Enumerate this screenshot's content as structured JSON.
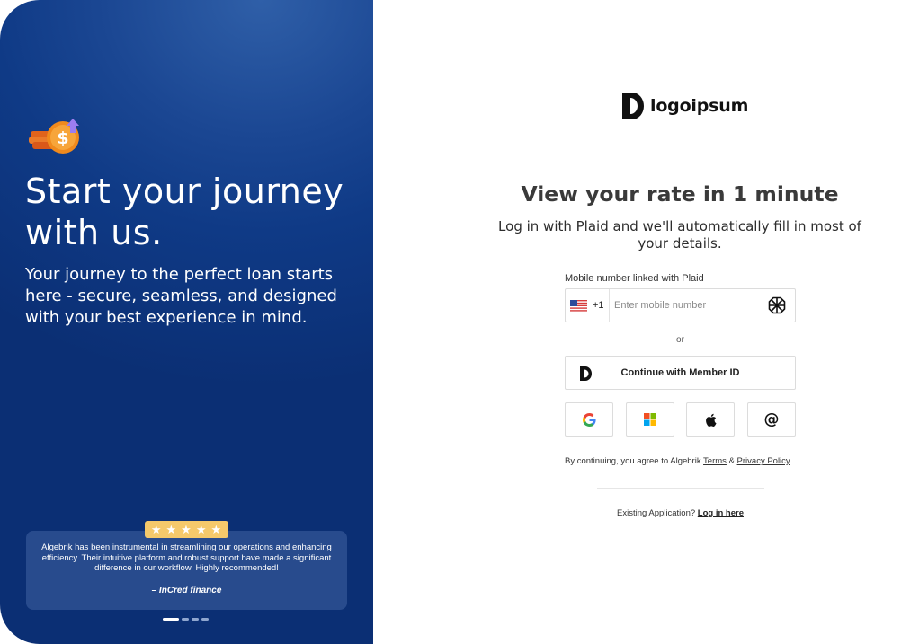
{
  "hero": {
    "title": "Start your journey with us.",
    "subtitle": "Your journey to the perfect loan starts here - secure, seamless, and designed with your best experience in mind.",
    "rating_stars": "★★★★★",
    "testimonial": "Algebrik has been instrumental in streamlining our operations and enhancing efficiency. Their intuitive platform and robust support have made a significant difference in our workflow. Highly recommended!",
    "testimonial_author": "– InCred finance",
    "carousel": {
      "total": 4,
      "active_index": 0
    },
    "colors": {
      "panel": "#0f3a86",
      "star_badge": "#f5c96b"
    }
  },
  "brand": {
    "name": "logoipsum",
    "mark_icon": "logo-mark-icon"
  },
  "login": {
    "heading": "View your rate in 1 minute",
    "subheading": "Log in with Plaid and we'll automatically fill in most of your details.",
    "phone_label": "Mobile number linked with Plaid",
    "country_flag_icon": "us-flag-icon",
    "country_code": "+1",
    "phone_placeholder": "Enter mobile number",
    "phone_value": "",
    "plaid_icon": "plaid-icon",
    "divider_text": "or",
    "member_button": "Continue with Member ID",
    "social_buttons": [
      "google-icon",
      "microsoft-icon",
      "apple-icon",
      "email-at-icon"
    ],
    "email_glyph": "@",
    "legal_prefix": "By continuing, you agree to Algebrik",
    "terms_link": "Terms",
    "legal_and": "&",
    "privacy_link": "Privacy Policy",
    "existing_prefix": "Existing Application?",
    "login_link": "Log in here"
  }
}
